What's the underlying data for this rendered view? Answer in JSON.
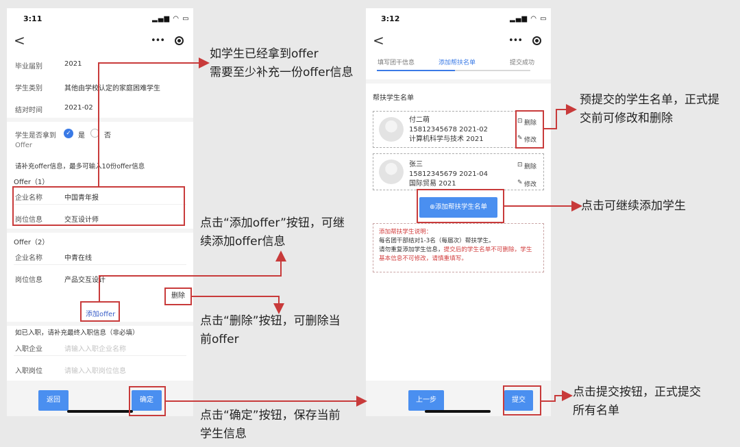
{
  "left_phone": {
    "status_time": "3:11",
    "status_icons": "▂▄▆ ◠ ▭",
    "nav": {
      "back": "<",
      "more": "•••"
    },
    "fields": {
      "graduation_label": "毕业届别",
      "graduation_value": "2021",
      "type_label": "学生类别",
      "type_value": "其他由学校认定的家庭困难学生",
      "pair_label": "结对时间",
      "pair_value": "2021-02"
    },
    "offer_question": {
      "label_line1": "学生是否拿到",
      "label_line2": "Offer",
      "yes": "是",
      "no": "否",
      "yes_check": "✓"
    },
    "offer_hint": "请补充offer信息，最多可输入10份offer信息",
    "offer1": {
      "title": "Offer（1）",
      "company_label": "企业名称",
      "company_value": "中国青年报",
      "position_label": "岗位信息",
      "position_value": "交互设计师"
    },
    "offer2": {
      "title": "Offer（2）",
      "company_label": "企业名称",
      "company_value": "中青在线",
      "position_label": "岗位信息",
      "position_value": "产品交互设计"
    },
    "add_offer": "添加offer",
    "delete_offer": "删除",
    "employment_hint": "如已入职，请补充最终入职信息（非必填）",
    "employ_company_label": "入职企业",
    "employ_company_placeholder": "请输入入职企业名称",
    "employ_position_label": "入职岗位",
    "employ_position_placeholder": "请输入入职岗位信息",
    "back_button": "返回",
    "confirm_button": "确定"
  },
  "right_phone": {
    "status_time": "3:12",
    "status_icons": "▂▄▆ ◠ ▭",
    "nav": {
      "back": "<",
      "more": "•••"
    },
    "steps": [
      "填写团干信息",
      "添加帮扶名单",
      "提交成功"
    ],
    "list_title": "帮扶学生名单",
    "students": [
      {
        "name": "付二萌",
        "phone_date": "15812345678 2021-02",
        "major_year": "计算机科学与技术 2021"
      },
      {
        "name": "张三",
        "phone_date": "15812345679 2021-04",
        "major_year": "国际贸易 2021"
      }
    ],
    "delete_label": "删除",
    "delete_icon": "⊡",
    "edit_label": "修改",
    "edit_icon": "✎",
    "add_student_button": "⊕添加帮扶学生名单",
    "note": {
      "title": "添加帮扶学生说明：",
      "line1": "每名团干部结对1-3名（每届次）帮扶学生。",
      "line2_black": "请勿重复添加学生信息，",
      "line2_red": "提交后的学生名单不可删除，学生基本信息不可修改，请慎重填写。"
    },
    "prev_button": "上一步",
    "submit_button": "提交"
  },
  "annotations": {
    "offer_required": [
      "如学生已经拿到offer",
      "需要至少补充一份offer信息"
    ],
    "add_offer": [
      "点击“添加offer”按钮，可继",
      "续添加offer信息"
    ],
    "delete_offer": [
      "点击“删除”按钮，可删除当",
      "前offer"
    ],
    "confirm": [
      "点击“确定”按钮，保存当前",
      "学生信息"
    ],
    "pre_submit": [
      "预提交的学生名单，正式提",
      "交前可修改和删除"
    ],
    "add_student": [
      "点击可继续添加学生"
    ],
    "submit": [
      "点击提交按钮，正式提交",
      "所有名单"
    ]
  },
  "colors": {
    "annotation_red": "#c83a3a",
    "primary_blue": "#4a8ff0",
    "background": "#e9e9e9"
  }
}
